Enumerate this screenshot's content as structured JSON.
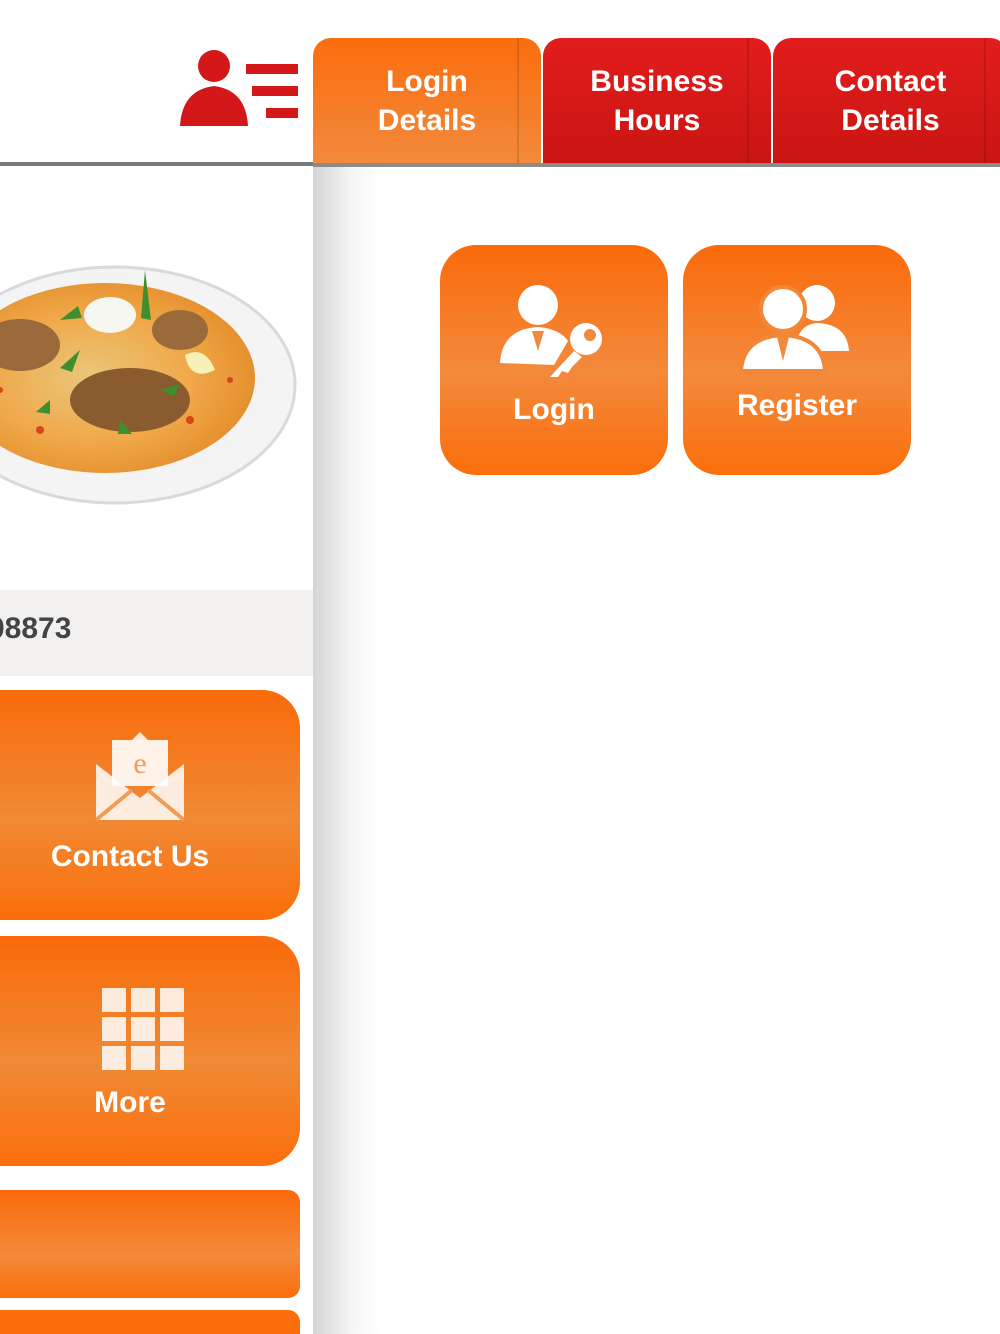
{
  "background_app": {
    "phone_partial": "08873",
    "tiles": [
      {
        "label": "Contact Us",
        "icon": "email-envelope-icon"
      },
      {
        "label": "More",
        "icon": "grid-icon"
      }
    ]
  },
  "drawer": {
    "tabs": [
      {
        "label_line1": "Login",
        "label_line2": "Details",
        "active": true
      },
      {
        "label_line1": "Business",
        "label_line2": "Hours",
        "active": false
      },
      {
        "label_line1": "Contact",
        "label_line2": "Details",
        "active": false
      }
    ],
    "actions": [
      {
        "label": "Login",
        "icon": "user-key-icon"
      },
      {
        "label": "Register",
        "icon": "users-icon"
      }
    ]
  },
  "colors": {
    "accent_orange": "#fb6d0d",
    "tab_red": "#d4181a",
    "menu_icon_red": "#d4181a"
  }
}
